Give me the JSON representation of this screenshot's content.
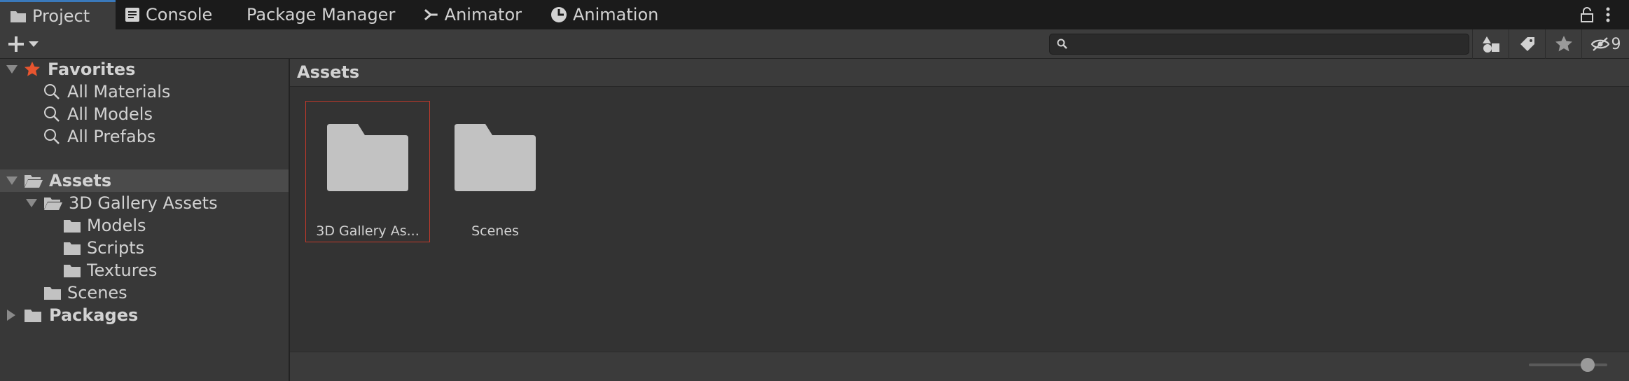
{
  "tabs": [
    {
      "label": "Project",
      "icon": "folder-icon",
      "active": true
    },
    {
      "label": "Console",
      "icon": "console-icon",
      "active": false
    },
    {
      "label": "Package Manager",
      "icon": "",
      "active": false
    },
    {
      "label": "Animator",
      "icon": "animator-icon",
      "active": false
    },
    {
      "label": "Animation",
      "icon": "clock-icon",
      "active": false
    }
  ],
  "toolbar": {
    "search_value": "",
    "hidden_count": "9"
  },
  "tree": {
    "favorites_label": "Favorites",
    "favorites": [
      "All Materials",
      "All Models",
      "All Prefabs"
    ],
    "assets_label": "Assets",
    "gallery_label": "3D Gallery Assets",
    "gallery_children": [
      "Models",
      "Scripts",
      "Textures"
    ],
    "scenes_label": "Scenes",
    "packages_label": "Packages"
  },
  "content": {
    "breadcrumb": "Assets",
    "items": [
      {
        "label": "3D Gallery As...",
        "selected": true
      },
      {
        "label": "Scenes",
        "selected": false
      }
    ],
    "zoom_slider_fraction": 0.75
  },
  "colors": {
    "accent_tab": "#3a79bb",
    "selection_border": "#c0392b",
    "favorites_star": "#e8552f",
    "folder": "#c2c2c2"
  }
}
